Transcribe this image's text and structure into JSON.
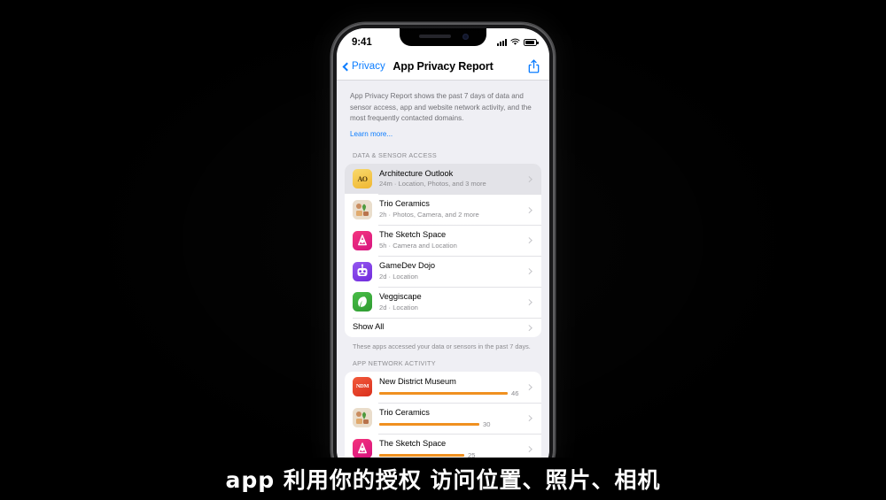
{
  "statusbar": {
    "time": "9:41",
    "signal_icon": "cellular-signal-icon",
    "wifi_icon": "wifi-icon",
    "battery_icon": "battery-icon"
  },
  "navbar": {
    "back_label": "Privacy",
    "title": "App Privacy Report",
    "share_icon": "share-icon"
  },
  "intro": {
    "text": "App Privacy Report shows the past 7 days of data and sensor access, app and website network activity, and the most frequently contacted domains.",
    "link": "Learn more..."
  },
  "data_sensor": {
    "section_title": "DATA & SENSOR ACCESS",
    "rows": [
      {
        "name": "Architecture Outlook",
        "detail": "24m · Location, Photos, and 3 more",
        "icon": "architecture-outlook-app-icon",
        "icon_text": "AO",
        "icon_bg": "#F5C549",
        "selected": true
      },
      {
        "name": "Trio Ceramics",
        "detail": "2h · Photos, Camera, and 2 more",
        "icon": "trio-ceramics-app-icon",
        "icon_text": "",
        "icon_bg": "#E8DCCB",
        "selected": false
      },
      {
        "name": "The Sketch Space",
        "detail": "5h · Camera and Location",
        "icon": "sketch-space-app-icon",
        "icon_text": "",
        "icon_bg": "#E8246E",
        "selected": false
      },
      {
        "name": "GameDev Dojo",
        "detail": "2d · Location",
        "icon": "gamedev-dojo-app-icon",
        "icon_text": "",
        "icon_bg": "#7B3FE4",
        "selected": false
      },
      {
        "name": "Veggiscape",
        "detail": "2d · Location",
        "icon": "veggiscape-app-icon",
        "icon_text": "",
        "icon_bg": "#34A83A",
        "selected": false
      }
    ],
    "show_all_label": "Show All",
    "footnote": "These apps accessed your data or sensors in the past 7 days."
  },
  "network_activity": {
    "section_title": "APP NETWORK ACTIVITY",
    "rows": [
      {
        "name": "New District Museum",
        "count": "46",
        "bar_pct": 100,
        "icon": "new-district-museum-app-icon",
        "icon_text": "NDM",
        "icon_bg": "#E8432A"
      },
      {
        "name": "Trio Ceramics",
        "count": "30",
        "bar_pct": 78,
        "icon": "trio-ceramics-app-icon",
        "icon_text": "",
        "icon_bg": "#E8DCCB"
      },
      {
        "name": "The Sketch Space",
        "count": "25",
        "bar_pct": 66,
        "icon": "sketch-space-app-icon",
        "icon_text": "",
        "icon_bg": "#E8246E"
      }
    ]
  },
  "subtitle": {
    "text": "app 利用你的授权 访问位置、照片、相机"
  },
  "colors": {
    "accent_blue": "#0a7cff",
    "bar_orange": "#f0901f",
    "screen_bg": "#efeff4",
    "selected_row": "#e3e3e8"
  }
}
